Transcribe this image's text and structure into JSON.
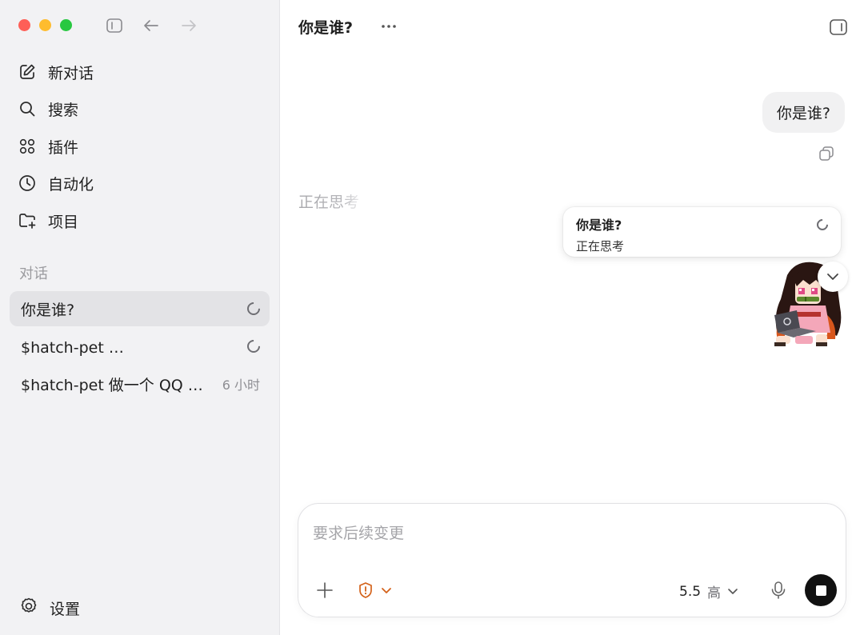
{
  "sidebar": {
    "nav": [
      {
        "label": "新对话",
        "icon": "compose-icon"
      },
      {
        "label": "搜索",
        "icon": "search-icon"
      },
      {
        "label": "插件",
        "icon": "plugins-grid-icon"
      },
      {
        "label": "自动化",
        "icon": "clock-icon"
      },
      {
        "label": "项目",
        "icon": "folder-add-icon"
      }
    ],
    "section_label": "对话",
    "conversations": [
      {
        "title": "你是谁?",
        "meta": "",
        "status": "loading",
        "active": true
      },
      {
        "title": "$hatch-pet 做一个 QQ 宠物",
        "meta": "",
        "status": "loading",
        "active": false
      },
      {
        "title": "$hatch-pet 做一个 QQ 宠物",
        "meta": "6 小时",
        "status": "done",
        "active": false
      }
    ],
    "settings_label": "设置"
  },
  "header": {
    "title": "你是谁?",
    "more_icon": "ellipsis-icon",
    "panel_icon": "side-panel-icon"
  },
  "chat": {
    "user_message": "你是谁?",
    "assistant_status": "正在思考",
    "popover": {
      "title": "你是谁?",
      "subtitle": "正在思考"
    }
  },
  "composer": {
    "placeholder": "要求后续变更",
    "model_version": "5.5",
    "reasoning_level": "高",
    "accent_color": "#d4621a"
  }
}
